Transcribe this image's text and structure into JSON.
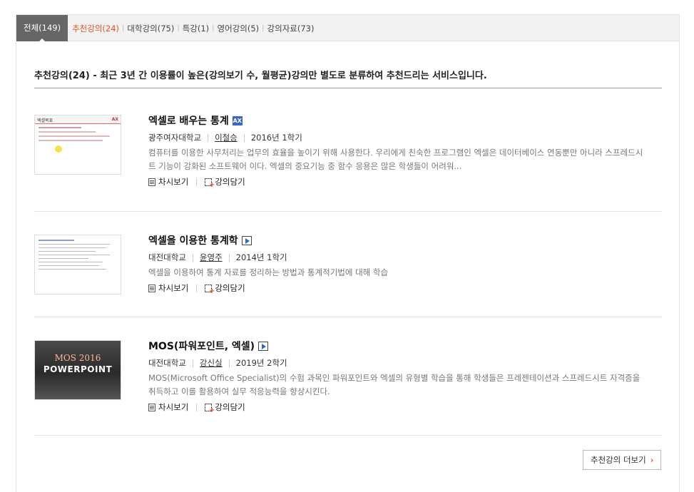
{
  "tabs": [
    {
      "label": "전체(149)"
    },
    {
      "label": "추천강의(24)"
    },
    {
      "label": "대학강의(75)"
    },
    {
      "label": "특강(1)"
    },
    {
      "label": "영어강의(5)"
    },
    {
      "label": "강의자료(73)"
    }
  ],
  "headline": "추천강의(24) - 최근 3년 간 이용률이 높은(강의보기 수, 월평균)강의만 별도로 분류하여 추천드리는 서비스입니다.",
  "items": [
    {
      "title": "엑셀로 배우는 통계",
      "badge": "AX",
      "university": "광주여자대학교",
      "professor": "이철승",
      "term": "2016년 1학기",
      "description": "컴퓨터를 이용한 사무처리는 업무의 효율을 높이기 위해 사용한다. 우리에게 친숙한 프로그램인 엑셀은 데이터베이스 연동뿐만 아니라 스프레드시트 기능이 강화된 소프트웨어 이다. 엑셀의 중요기능 중 함수 응용은 많은 학생들이 어려워...",
      "thumb_heading": "엑셀목표",
      "thumb_brand": "AX"
    },
    {
      "title": "엑셀을 이용한 통계학",
      "badge": "",
      "university": "대전대학교",
      "professor": "윤영주",
      "term": "2014년 1학기",
      "description": "엑셀을 이용하여 통계 자료를 정리하는 방법과 통계적기법에 대해 학습",
      "thumb_heading": "",
      "thumb_brand": ""
    },
    {
      "title": "MOS(파워포인트, 엑셀)",
      "badge": "",
      "university": "대전대학교",
      "professor": "강신실",
      "term": "2019년 2학기",
      "description": "MOS(Microsoft Office Specialist)의 수험 과목인 파워포인트와 엑셀의 유형별 학습을 통해 학생들은 프레젠테이션과 스프레드시트 자격증을 취득하고 이를 활용하여 실무 적응능력을 향상시킨다.",
      "thumb_heading": "MOS 2016",
      "thumb_brand": "POWERPOINT"
    }
  ],
  "actions": {
    "view_sessions": "차시보기",
    "add_lecture": "강의담기"
  },
  "more_button": "추천강의 더보기",
  "colors": {
    "accent": "#e8541e",
    "active_tab": "#666666",
    "tab_bar": "#f2f2f2"
  }
}
